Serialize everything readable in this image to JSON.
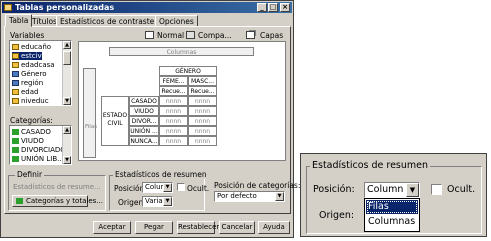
{
  "window": {
    "title": "Tablas personalizadas",
    "min_glyph": "_",
    "max_glyph": "□",
    "close_glyph": "×"
  },
  "tabs": [
    {
      "label": "Tabla"
    },
    {
      "label": "Títulos"
    },
    {
      "label": "Estadísticos de contraste"
    },
    {
      "label": "Opciones"
    }
  ],
  "variables": {
    "label": "Variables",
    "items": [
      "educaño",
      "estciv",
      "edadcasa",
      "Género",
      "región",
      "edad",
      "niveduc"
    ]
  },
  "categories": {
    "label": "Categorías:",
    "items": [
      "CASADO",
      "VIUDO",
      "DIVORCIADO",
      "UNIÓN LIB..."
    ]
  },
  "toolbar": {
    "normal": "Normal",
    "compact": "Compa...",
    "layers": "Capas"
  },
  "table_preview": {
    "columns_label": "Columnas",
    "rows_label": "Filas",
    "col_header": "GÉNERO",
    "col_categories": [
      "FEME...",
      "MASC..."
    ],
    "stat_label": "Recue...",
    "row_var": "ESTADO CIVIL",
    "row_categories": [
      "CASADO",
      "VIUDO",
      "DIVOR...",
      "UNIÓN ...",
      "NUNCA..."
    ],
    "cell_value": "nnnn"
  },
  "define": {
    "title": "Definir",
    "stats_button": "Estadísticos de resume...",
    "categories_button": "Categorías y totales..."
  },
  "summary": {
    "title": "Estadísticos de resumen",
    "position_label": "Posición:",
    "position_value": "Column",
    "hide_label": "Ocult.",
    "source_label": "Origen:",
    "source_value": "Variabl"
  },
  "category_position": {
    "label": "Posición de categorías:",
    "value": "Por defecto"
  },
  "buttons": {
    "ok": "Aceptar",
    "paste": "Pegar",
    "reset": "Restablecer",
    "cancel": "Cancelar",
    "help": "Ayuda"
  },
  "zoom": {
    "title": "Estadísticos de resumen",
    "position_label": "Posición:",
    "position_value": "Column",
    "hide_label": "Ocult.",
    "source_label": "Origen:",
    "options": [
      "Filas",
      "Columnas"
    ],
    "selected_option": "Filas"
  },
  "colors": {
    "title_bar": "#0a246a",
    "selection": "#0a246a",
    "category_swatch": "#2ca02c"
  }
}
